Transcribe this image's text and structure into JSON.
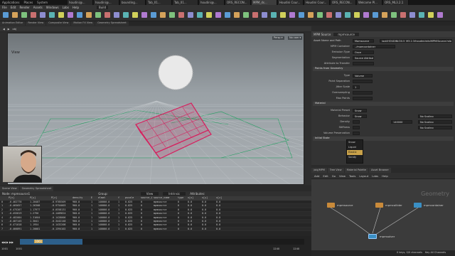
{
  "system_bar": {
    "items": [
      "Applications",
      "Places",
      "System"
    ]
  },
  "browser_tabs": [
    "houdini@...",
    "houdini@...",
    "bounding...",
    "Tab_01...",
    "Tab_01...",
    "houdini@...",
    "ORS_RECON...",
    "MPM_ds...",
    "Houdini Cour...",
    "Houdini Cour...",
    "ORS_RECON...",
    "Welcome Pl...",
    "ORS_ML3.2.1"
  ],
  "menubar": {
    "items": [
      "File",
      "Edit",
      "Render",
      "Assets",
      "Windows",
      "Labs",
      "Help"
    ],
    "build": "Build"
  },
  "desktop_tabs": [
    "Animation Editor",
    "Render View",
    "Composite View",
    "Motion FX View",
    "Geometry Spreadsheet"
  ],
  "viewport": {
    "title": "View",
    "path": "obj",
    "overlay_label": "View",
    "badges": [
      "Persp ▾",
      "No cam ▾"
    ]
  },
  "spreadsheet": {
    "tabs": [
      "Scene View",
      "Geometry Spreadsheet"
    ],
    "node": "Node: mpmsource1",
    "group_label": "Group:",
    "view_label": "View",
    "intrinsics_label": "Intrinsic",
    "attributes_label": "Attributes:",
    "columns": [
      "",
      "P[x]",
      "P[y]",
      "P[z]",
      "density",
      "E",
      "elmat",
      "f",
      "pscale",
      "source_id",
      "source_name",
      "type",
      "v[x]",
      "v[y]",
      "v[z]"
    ],
    "rows": [
      [
        "0",
        "-0.462778",
        "1.20487",
        "-0.9785509",
        "960.0",
        "1",
        "140000.0",
        "1",
        "0.025",
        "0",
        "mpmsource",
        "0",
        "0.0",
        "0.0",
        "0.0"
      ],
      [
        "1",
        "-0.465657",
        "1.26308",
        "-0.9754003",
        "960.0",
        "1",
        "140000.0",
        "1",
        "0.025",
        "0",
        "mpmsource",
        "0",
        "0.0",
        "0.0",
        "0.0"
      ],
      [
        "2",
        "-0.475267",
        "1.17977",
        "-0.0358131",
        "960.0",
        "1",
        "140000.0",
        "1",
        "0.025",
        "0",
        "mpmsource",
        "0",
        "0.0",
        "0.0",
        "0.0"
      ],
      [
        "3",
        "-0.455819",
        "1.2796",
        "-0.1409824",
        "960.0",
        "1",
        "140000.0",
        "1",
        "0.025",
        "0",
        "mpmsource",
        "0",
        "0.0",
        "0.0",
        "0.0"
      ],
      [
        "4",
        "-0.482004",
        "1.31604",
        "-0.1428006",
        "960.0",
        "1",
        "140000.0",
        "1",
        "0.025",
        "0",
        "mpmsource",
        "0",
        "0.0",
        "0.0",
        "0.0"
      ],
      [
        "5",
        "-0.487145",
        "1.3041",
        "-0.3442148",
        "960.0",
        "1",
        "140000.0",
        "1",
        "0.025",
        "0",
        "mpmsource",
        "0",
        "0.0",
        "0.0",
        "0.0"
      ],
      [
        "6",
        "-0.471018",
        "1.1954",
        "-0.1432208",
        "960.0",
        "1",
        "140000.0",
        "1",
        "0.025",
        "0",
        "mpmsource",
        "0",
        "0.0",
        "0.0",
        "0.0"
      ],
      [
        "7",
        "-0.466891",
        "1.20081",
        "-0.1394102",
        "960.0",
        "1",
        "140000.0",
        "1",
        "0.025",
        "0",
        "mpmsource",
        "0",
        "0.0",
        "0.0",
        "0.0"
      ]
    ]
  },
  "playbar": {
    "frame_current": "1061",
    "frame_start": "1001",
    "frame_start2": "1001",
    "frame_end": "1240",
    "frame_end2": "1240",
    "progress": 0.22,
    "keys_info": "0 keys, 0/0 channels",
    "key_all": "Key All Channels",
    "auto_update": "Auto Update"
  },
  "params": {
    "node_type": "MPM Source",
    "node_name": "mpmsource",
    "tabs": [
      "Asset Name and Path",
      "Mpmsource"
    ],
    "path_field": "/opt/HOUDINI/20.5_M3.2.3/houdini/otls/MPM/Source.hda",
    "rows": [
      {
        "label": "MPM Container",
        "value": "../mpmcontainer"
      },
      {
        "label": "Emission Type",
        "value": "Once"
      },
      {
        "label": "Segmentation",
        "value": "Source Attribute"
      },
      {
        "label": "Attribute to Transfer",
        "value": ""
      }
    ],
    "section_points": "Points from Geometry",
    "points_rows": [
      {
        "label": "Type",
        "value": "Volume"
      },
      {
        "label": "Point Separation",
        "value": ""
      },
      {
        "label": "Jitter Scale",
        "value": "1"
      },
      {
        "label": "Oversampling",
        "value": ""
      },
      {
        "label": "Max Points",
        "value": ""
      }
    ],
    "section_material": "Material",
    "material_rows": [
      {
        "label": "Material Preset",
        "value": "Snow"
      },
      {
        "label": "Behavior",
        "value": "Snow"
      },
      {
        "label": "Density",
        "value": ""
      },
      {
        "label": "Stiffness",
        "value": ""
      },
      {
        "label": "Volume Preservation",
        "value": ""
      }
    ],
    "stiffness_number": "140000",
    "scaling_options": [
      "No Scaling",
      "No Scaling",
      "No Scaling"
    ],
    "section_initial": "Initial State",
    "dropdown_options": [
      "Snow",
      "Liquid",
      "Elastic",
      "Sandy"
    ],
    "dropdown_selected": "Elastic"
  },
  "network": {
    "tabs": [
      "/obj/MPM",
      "Tree View",
      "Material Palette",
      "Asset Browser"
    ],
    "menu": [
      "Add",
      "Edit",
      "Go",
      "View",
      "Tools",
      "Layout",
      "Labs",
      "Help"
    ],
    "path": "obj",
    "context_label": "Geometry",
    "nodes": [
      "mpmsource",
      "mpmcollider",
      "mpmcontainer",
      "mpmsolver"
    ]
  },
  "colors": {
    "accent": "#c9a24a",
    "wireframe": "#d6205e",
    "grid": "#20a060",
    "timeline": "#2d5f8a",
    "node_blue": "#3a8fc4",
    "node_orange": "#c98a3a"
  }
}
